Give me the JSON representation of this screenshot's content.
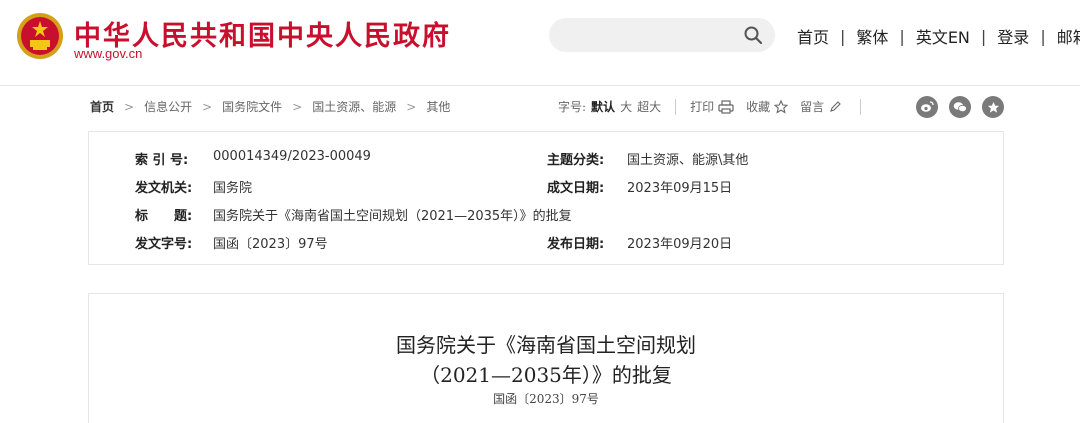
{
  "header": {
    "site_title": "中华人民共和国中央人民政府",
    "site_url": "www.gov.cn",
    "search_placeholder": "",
    "nav": [
      {
        "label": "首页"
      },
      {
        "label": "繁体"
      },
      {
        "label": "英文EN"
      },
      {
        "label": "登录"
      },
      {
        "label": "邮箱"
      }
    ],
    "separator": "|"
  },
  "breadcrumb": {
    "items": [
      "首页",
      "信息公开",
      "国务院文件",
      "国土资源、能源",
      "其他"
    ],
    "arrow": ">"
  },
  "tools": {
    "font_size_label": "字号:",
    "font_default": "默认",
    "font_large": "大",
    "font_xlarge": "超大",
    "print": "打印",
    "favorite": "收藏",
    "comment": "留言"
  },
  "social": [
    "weibo-icon",
    "wechat-icon",
    "star-icon"
  ],
  "info": {
    "index_no_label": "索 引 号:",
    "index_no": "000014349/2023-00049",
    "category_label": "主题分类:",
    "category": "国土资源、能源\\其他",
    "issuer_label": "发文机关:",
    "issuer": "国务院",
    "date_written_label": "成文日期:",
    "date_written": "2023年09月15日",
    "title_label": "标　　题:",
    "title": "国务院关于《海南省国土空间规划（2021—2035年）》的批复",
    "doc_no_label": "发文字号:",
    "doc_no": "国函〔2023〕97号",
    "date_published_label": "发布日期:",
    "date_published": "2023年09月20日"
  },
  "document": {
    "title_line1": "国务院关于《海南省国土空间规划",
    "title_line2": "（2021—2035年）》的批复",
    "doc_no": "国函〔2023〕97号"
  },
  "colors": {
    "brand_red": "#c8102e",
    "icon_gray": "#7a7a7a"
  }
}
